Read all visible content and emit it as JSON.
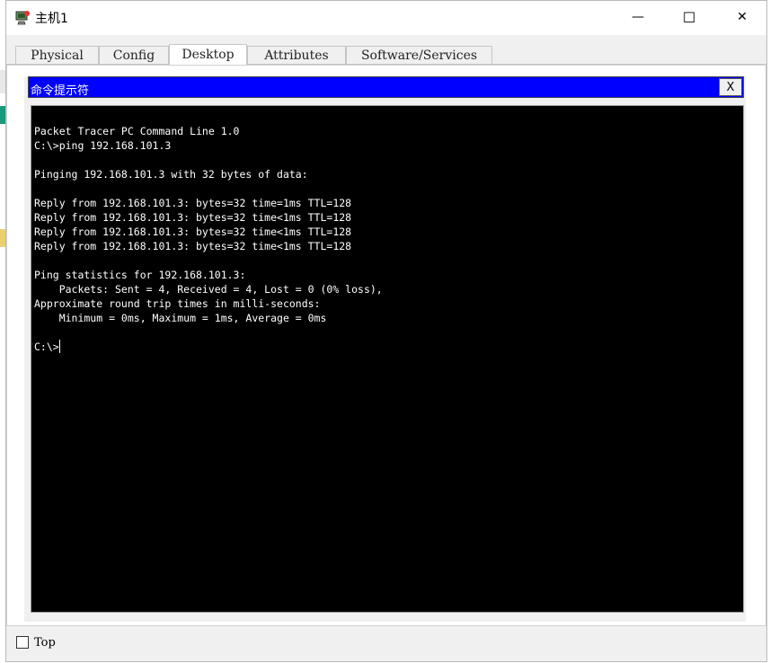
{
  "window": {
    "title": "主机1",
    "minimize_glyph": "—",
    "maximize_glyph": "☐",
    "close_glyph": "✕"
  },
  "tabs": [
    {
      "label": "Physical",
      "active": false
    },
    {
      "label": "Config",
      "active": false
    },
    {
      "label": "Desktop",
      "active": true
    },
    {
      "label": "Attributes",
      "active": false
    },
    {
      "label": "Software/Services",
      "active": false
    }
  ],
  "command_prompt": {
    "title": "命令提示符",
    "close_label": "X",
    "lines": [
      "Packet Tracer PC Command Line 1.0",
      "C:\\>ping 192.168.101.3",
      "",
      "Pinging 192.168.101.3 with 32 bytes of data:",
      "",
      "Reply from 192.168.101.3: bytes=32 time=1ms TTL=128",
      "Reply from 192.168.101.3: bytes=32 time<1ms TTL=128",
      "Reply from 192.168.101.3: bytes=32 time<1ms TTL=128",
      "Reply from 192.168.101.3: bytes=32 time<1ms TTL=128",
      "",
      "Ping statistics for 192.168.101.3:",
      "    Packets: Sent = 4, Received = 4, Lost = 0 (0% loss),",
      "Approximate round trip times in milli-seconds:",
      "    Minimum = 0ms, Maximum = 1ms, Average = 0ms",
      ""
    ],
    "prompt": "C:\\>"
  },
  "footer": {
    "top_checkbox_label": "Top",
    "top_checked": false
  },
  "colors": {
    "cmd_titlebar": "#0000ff",
    "terminal_bg": "#000000",
    "terminal_text": "#ffffff"
  }
}
